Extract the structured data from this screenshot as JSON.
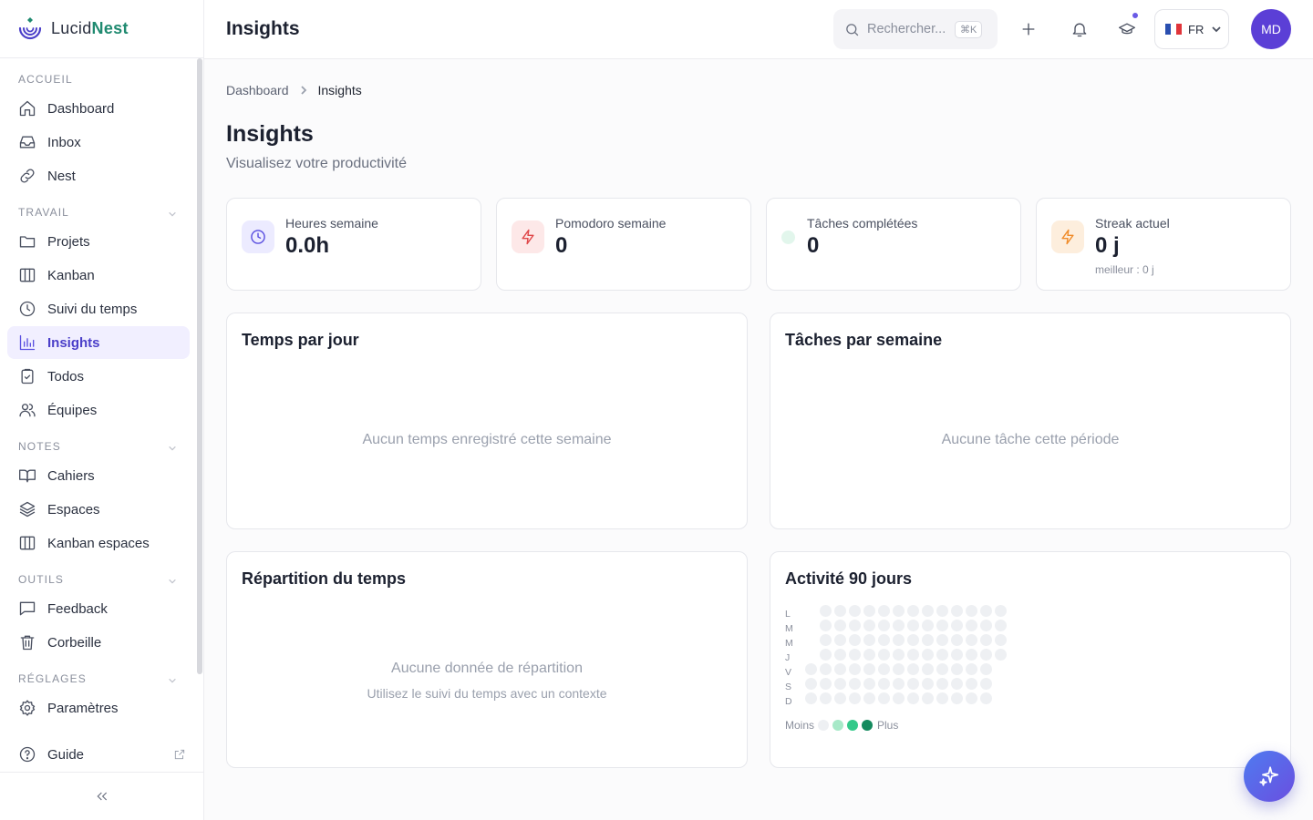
{
  "brand": {
    "name_part1": "Lucid",
    "name_part2": "Nest",
    "accent": "#1f8a70"
  },
  "sidebar": {
    "sections": {
      "accueil": "ACCUEIL",
      "travail": "TRAVAIL",
      "notes": "NOTES",
      "outils": "OUTILS",
      "reglages": "RÉGLAGES"
    },
    "items": {
      "dashboard": "Dashboard",
      "inbox": "Inbox",
      "nest": "Nest",
      "projets": "Projets",
      "kanban": "Kanban",
      "suivi": "Suivi du temps",
      "insights": "Insights",
      "todos": "Todos",
      "equipes": "Équipes",
      "cahiers": "Cahiers",
      "espaces": "Espaces",
      "kanban_espaces": "Kanban espaces",
      "feedback": "Feedback",
      "corbeille": "Corbeille",
      "parametres": "Paramètres"
    },
    "active_item": "Insights",
    "guide": "Guide"
  },
  "header": {
    "title": "Insights",
    "search_placeholder": "Rechercher...",
    "search_shortcut": "⌘K",
    "language": "FR",
    "avatar_initials": "MD"
  },
  "breadcrumb": {
    "root": "Dashboard",
    "current": "Insights"
  },
  "page": {
    "title": "Insights",
    "subtitle": "Visualisez votre productivité"
  },
  "stats": [
    {
      "label": "Heures semaine",
      "value": "0.0h",
      "icon": "clock-icon",
      "color": "#5a4fe0"
    },
    {
      "label": "Pomodoro semaine",
      "value": "0",
      "icon": "bolt-icon",
      "color": "#e0484a"
    },
    {
      "label": "Tâches complétées",
      "value": "0",
      "icon": "green-dot",
      "color": "#2fbf80"
    },
    {
      "label": "Streak actuel",
      "value": "0 j",
      "sub": "meilleur : 0 j",
      "icon": "bolt-icon",
      "color": "#f08c2a"
    }
  ],
  "cards": {
    "temps_par_jour": {
      "title": "Temps par jour",
      "empty": "Aucun temps enregistré cette semaine"
    },
    "taches_par_semaine": {
      "title": "Tâches par semaine",
      "empty": "Aucune tâche cette période"
    },
    "repartition": {
      "title": "Répartition du temps",
      "empty": "Aucune donnée de répartition",
      "hint": "Utilisez le suivi du temps avec un contexte"
    },
    "activite": {
      "title": "Activité 90 jours",
      "day_labels": [
        "L",
        "M",
        "M",
        "J",
        "V",
        "S",
        "D"
      ],
      "legend_less": "Moins",
      "legend_more": "Plus",
      "legend_colors": [
        "#eef0f3",
        "#a7e9c8",
        "#34c98a",
        "#148a5e"
      ],
      "active_days": 0
    }
  }
}
